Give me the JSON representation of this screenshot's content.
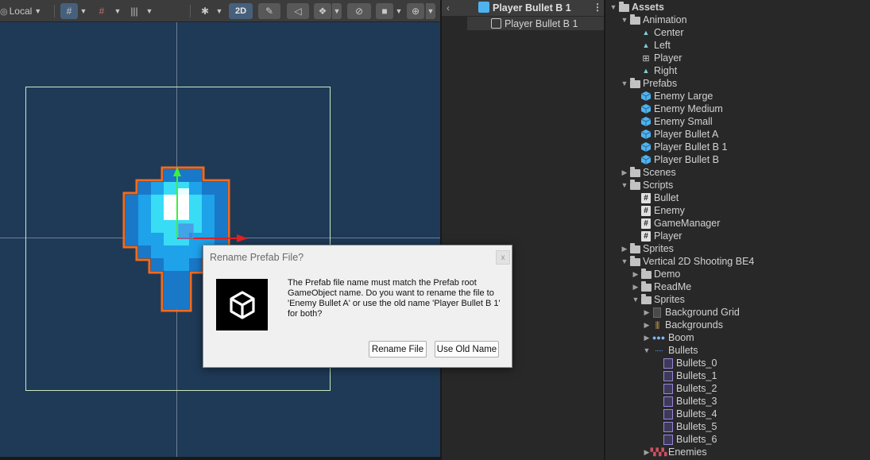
{
  "scene": {
    "toolbar": {
      "pivot_label": "Local",
      "mode_2d_label": "2D"
    }
  },
  "hierarchy": {
    "header_title": "Player Bullet B 1",
    "root_item": "Player Bullet B 1"
  },
  "project": {
    "items": [
      {
        "label": "Assets",
        "type": "folder",
        "level": 0,
        "expanded": true
      },
      {
        "label": "Animation",
        "type": "folder",
        "level": 1,
        "expanded": true
      },
      {
        "label": "Center",
        "type": "anim-clip",
        "level": 2
      },
      {
        "label": "Left",
        "type": "anim-clip",
        "level": 2
      },
      {
        "label": "Player",
        "type": "animator",
        "level": 2
      },
      {
        "label": "Right",
        "type": "anim-clip",
        "level": 2
      },
      {
        "label": "Prefabs",
        "type": "folder",
        "level": 1,
        "expanded": true
      },
      {
        "label": "Enemy Large",
        "type": "prefab",
        "level": 2
      },
      {
        "label": "Enemy Medium",
        "type": "prefab",
        "level": 2
      },
      {
        "label": "Enemy Small",
        "type": "prefab",
        "level": 2
      },
      {
        "label": "Player Bullet A",
        "type": "prefab",
        "level": 2
      },
      {
        "label": "Player Bullet B 1",
        "type": "prefab",
        "level": 2
      },
      {
        "label": "Player Bullet B",
        "type": "prefab",
        "level": 2
      },
      {
        "label": "Scenes",
        "type": "folder",
        "level": 1,
        "expanded": false
      },
      {
        "label": "Scripts",
        "type": "folder",
        "level": 1,
        "expanded": true
      },
      {
        "label": "Bullet",
        "type": "script",
        "level": 2
      },
      {
        "label": "Enemy",
        "type": "script",
        "level": 2
      },
      {
        "label": "GameManager",
        "type": "script",
        "level": 2
      },
      {
        "label": "Player",
        "type": "script",
        "level": 2
      },
      {
        "label": "Sprites",
        "type": "folder",
        "level": 1,
        "expanded": false
      },
      {
        "label": "Vertical 2D Shooting BE4",
        "type": "folder",
        "level": 1,
        "expanded": true
      },
      {
        "label": "Demo",
        "type": "folder",
        "level": 2,
        "expanded": false
      },
      {
        "label": "ReadMe",
        "type": "folder",
        "level": 2,
        "expanded": false
      },
      {
        "label": "Sprites",
        "type": "folder",
        "level": 2,
        "expanded": true
      },
      {
        "label": "Background Grid",
        "type": "texture",
        "level": 3,
        "collapsible": true
      },
      {
        "label": "Backgrounds",
        "type": "texture-multi",
        "level": 3,
        "collapsible": true
      },
      {
        "label": "Boom",
        "type": "texture-boom",
        "level": 3,
        "collapsible": true
      },
      {
        "label": "Bullets",
        "type": "texture-bullets",
        "level": 3,
        "collapsible": true,
        "expanded": true
      },
      {
        "label": "Bullets_0",
        "type": "sprite",
        "level": 4
      },
      {
        "label": "Bullets_1",
        "type": "sprite",
        "level": 4
      },
      {
        "label": "Bullets_2",
        "type": "sprite",
        "level": 4
      },
      {
        "label": "Bullets_3",
        "type": "sprite",
        "level": 4
      },
      {
        "label": "Bullets_4",
        "type": "sprite",
        "level": 4
      },
      {
        "label": "Bullets_5",
        "type": "sprite",
        "level": 4
      },
      {
        "label": "Bullets_6",
        "type": "sprite",
        "level": 4
      },
      {
        "label": "Enemies",
        "type": "texture-enemies",
        "level": 3,
        "collapsible": true
      }
    ]
  },
  "dialog": {
    "title": "Rename Prefab File?",
    "message": "The Prefab file name must match the Prefab root GameObject name. Do you want to rename the file to 'Enemy Bullet A' or use the old name 'Player Bullet B 1' for both?",
    "rename_button": "Rename File",
    "old_name_button": "Use Old Name",
    "close_glyph": "x"
  },
  "colors": {
    "scene_background": "#1f3a57",
    "selection_outline": "#f26b1d",
    "prefab_icon": "#4fb3f0",
    "accent_active": "#46607c"
  }
}
